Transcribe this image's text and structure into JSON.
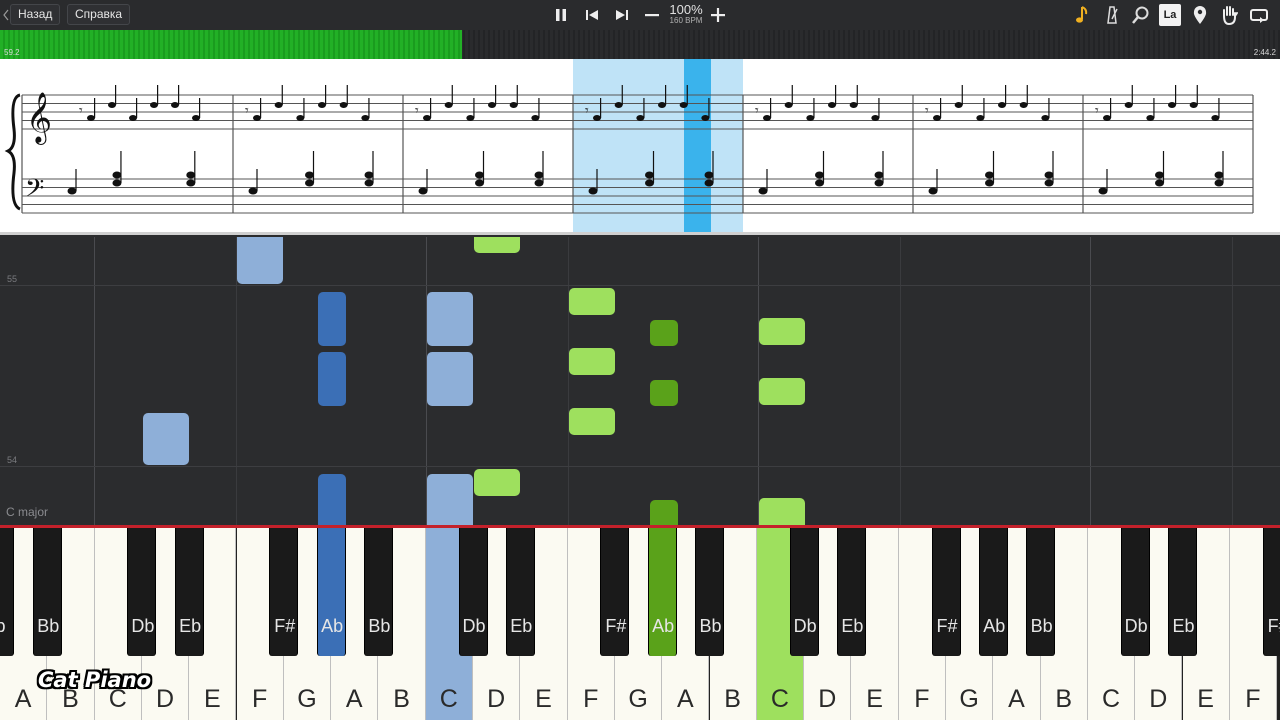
{
  "toolbar": {
    "back_label": "Назад",
    "help_label": "Справка",
    "speed_percent": "100%",
    "tempo": "160 BPM",
    "icons": [
      "pause-icon",
      "skip-back-icon",
      "skip-forward-icon",
      "minus-icon",
      "plus-icon",
      "note-icon",
      "metronome-icon",
      "search-icon",
      "note-names-icon",
      "location-pin-icon",
      "hand-icon",
      "loop-icon"
    ],
    "note_names_label": "La"
  },
  "progress": {
    "elapsed": "59.2",
    "total": "2:44.2",
    "fraction": 0.361
  },
  "roll": {
    "measure_labels": [
      "55",
      "54"
    ],
    "key_label": "C major",
    "colors": {
      "left_hand": "#3b6fb6",
      "left_hand_light": "#8eafd8",
      "right_hand": "#9ee05e",
      "right_hand_dark": "#5aa21a"
    }
  },
  "keyboard": {
    "white_keys": [
      "A",
      "B",
      "C",
      "D",
      "E",
      "F",
      "G",
      "A",
      "B",
      "C",
      "D",
      "E",
      "F",
      "G",
      "A",
      "B",
      "C",
      "D",
      "E",
      "F",
      "G",
      "A",
      "B",
      "C",
      "D",
      "E",
      "F"
    ],
    "black_keys": [
      "Bb",
      "Db",
      "Eb",
      "F#",
      "Ab",
      "Bb",
      "Db",
      "Eb",
      "F#",
      "Ab",
      "Bb",
      "Db",
      "Eb",
      "F#",
      "Ab",
      "Bb",
      "Db",
      "Eb",
      "F#"
    ],
    "first_black_partial": "b",
    "last_black_partial": "F#"
  },
  "watermark": "Cat Piano"
}
